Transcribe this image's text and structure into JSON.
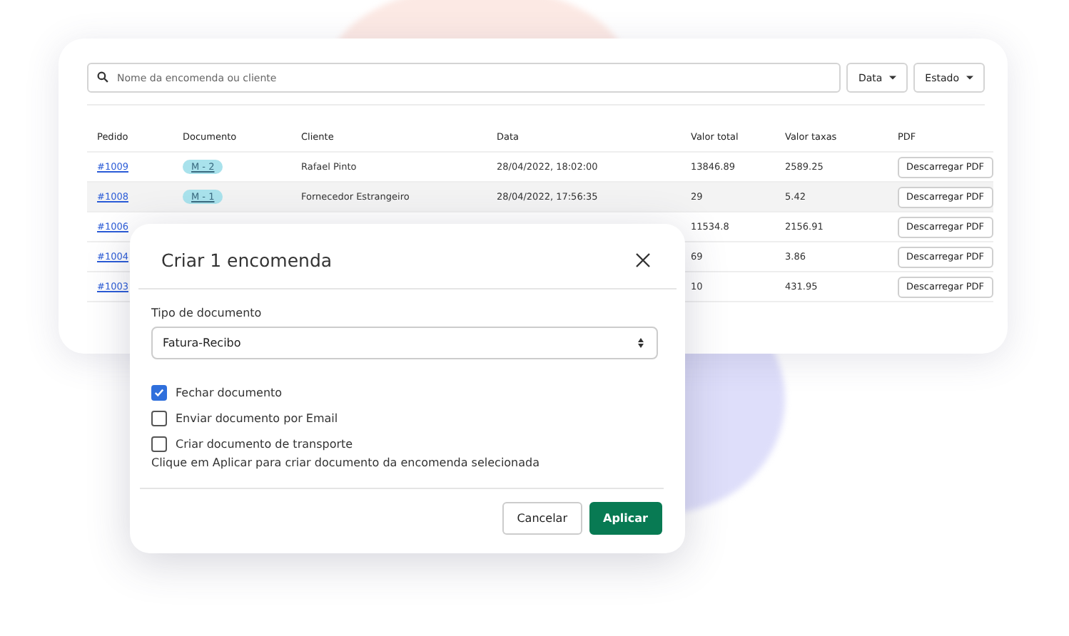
{
  "search": {
    "placeholder": "Nome da encomenda ou cliente"
  },
  "filters": [
    {
      "label": "Data"
    },
    {
      "label": "Estado"
    }
  ],
  "table": {
    "columns": [
      "Pedido",
      "Documento",
      "Cliente",
      "Data",
      "Valor total",
      "Valor taxas",
      "PDF"
    ],
    "rows": [
      {
        "selected": false,
        "pedido": "#1009",
        "documento": "M - 2",
        "cliente": "Rafael Pinto",
        "data": "28/04/2022, 18:02:00",
        "valor_total": "13846.89",
        "valor_taxas": "2589.25",
        "pdf": "Descarregar PDF"
      },
      {
        "selected": true,
        "pedido": "#1008",
        "documento": "M - 1",
        "cliente": "Fornecedor Estrangeiro",
        "data": "28/04/2022, 17:56:35",
        "valor_total": "29",
        "valor_taxas": "5.42",
        "pdf": "Descarregar PDF"
      },
      {
        "selected": false,
        "pedido": "#1006",
        "valor_total": "11534.8",
        "valor_taxas": "2156.91",
        "pdf": "Descarregar PDF"
      },
      {
        "selected": false,
        "pedido": "#1004",
        "valor_total": "69",
        "valor_taxas": "3.86",
        "pdf": "Descarregar PDF"
      },
      {
        "selected": false,
        "pedido": "#1003",
        "valor_total": "10",
        "valor_taxas": "431.95",
        "pdf": "Descarregar PDF"
      }
    ]
  },
  "dialog": {
    "title": "Criar 1 encomenda",
    "field_label": "Tipo de documento",
    "select_value": "Fatura-Recibo",
    "options": [
      {
        "label": "Fechar documento",
        "checked": true
      },
      {
        "label": "Enviar documento por Email",
        "checked": false
      },
      {
        "label": "Criar documento de transporte",
        "checked": false
      }
    ],
    "note": "Clique em Aplicar para criar documento da encomenda selecionada",
    "buttons": [
      {
        "label": "Cancelar",
        "kind": "secondary"
      },
      {
        "label": "Aplicar",
        "kind": "primary"
      }
    ]
  }
}
